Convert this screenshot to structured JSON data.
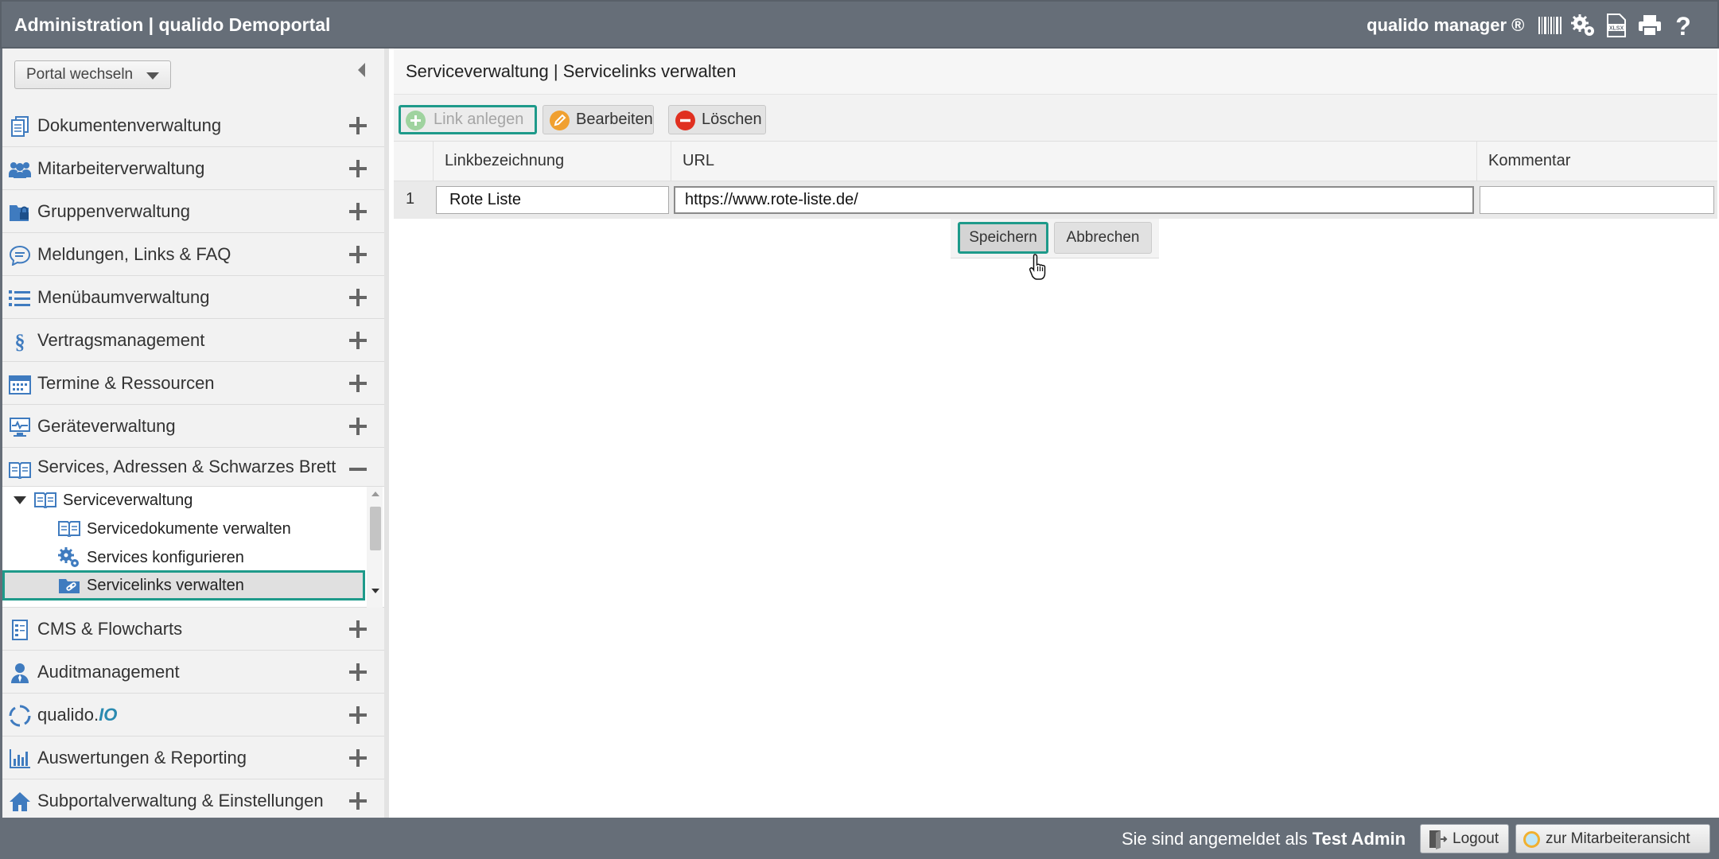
{
  "header": {
    "title": "Administration | qualido Demoportal",
    "brand": "qualido manager ®"
  },
  "sidebar": {
    "portal_select": "Portal wechseln",
    "items": [
      {
        "label": "Dokumentenverwaltung",
        "icon": "documents-icon"
      },
      {
        "label": "Mitarbeiterverwaltung",
        "icon": "users-icon"
      },
      {
        "label": "Gruppenverwaltung",
        "icon": "group-lock-icon"
      },
      {
        "label": "Meldungen, Links & FAQ",
        "icon": "chat-icon"
      },
      {
        "label": "Menübaumverwaltung",
        "icon": "list-icon"
      },
      {
        "label": "Vertragsmanagement",
        "icon": "paragraph-icon"
      },
      {
        "label": "Termine & Ressourcen",
        "icon": "calendar-icon"
      },
      {
        "label": "Geräteverwaltung",
        "icon": "monitor-icon"
      },
      {
        "label": "Services, Adressen & Schwarzes Brett",
        "icon": "book-icon"
      },
      {
        "label": "CMS & Flowcharts",
        "icon": "flowchart-icon"
      },
      {
        "label": "Auditmanagement",
        "icon": "auditor-icon"
      },
      {
        "label_main": "qualido.",
        "label_accent": "IO",
        "icon": "circle-icon"
      },
      {
        "label": "Auswertungen & Reporting",
        "icon": "bar-chart-icon"
      },
      {
        "label": "Subportalverwaltung & Einstellungen",
        "icon": "home-icon"
      }
    ],
    "tree": {
      "parent": "Serviceverwaltung",
      "children": [
        "Servicedokumente verwalten",
        "Services konfigurieren",
        "Servicelinks verwalten"
      ]
    }
  },
  "main": {
    "title": "Serviceverwaltung | Servicelinks verwalten",
    "toolbar": {
      "add": "Link anlegen",
      "edit": "Bearbeiten",
      "delete": "Löschen"
    },
    "grid": {
      "columns": [
        "Linkbezeichnung",
        "URL",
        "Kommentar"
      ],
      "rows": [
        {
          "num": "1",
          "name": "Rote Liste",
          "url": "https://www.rote-liste.de/",
          "comment": ""
        }
      ]
    },
    "row_actions": {
      "save": "Speichern",
      "cancel": "Abbrechen"
    }
  },
  "footer": {
    "login_prefix": "Sie sind angemeldet als ",
    "user": "Test Admin",
    "logout": "Logout",
    "employee_view": "zur Mitarbeiteransicht"
  },
  "colors": {
    "topbar": "#666e78",
    "selection_outline": "#1e9a8a",
    "nav_icon": "#3f7bbf",
    "add_green": "#7cc47c",
    "edit_orange": "#f0a030",
    "delete_red": "#e03020"
  }
}
